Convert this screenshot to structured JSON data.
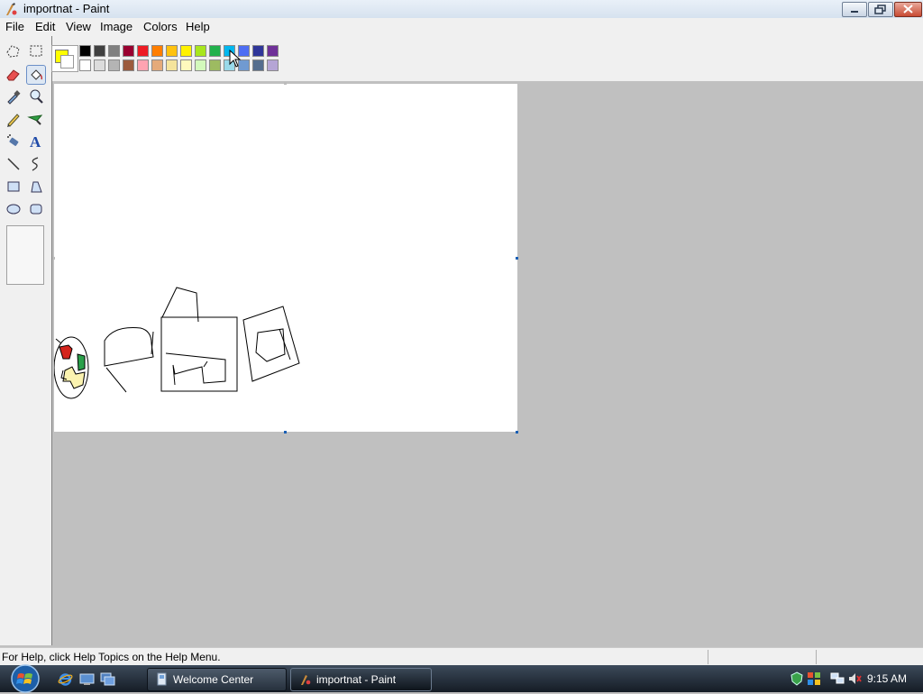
{
  "window": {
    "title": "importnat - Paint"
  },
  "menu": [
    "File",
    "Edit",
    "View",
    "Image",
    "Colors",
    "Help"
  ],
  "tools": [
    {
      "name": "free-form-select",
      "selected": false
    },
    {
      "name": "select",
      "selected": false
    },
    {
      "name": "eraser",
      "selected": false
    },
    {
      "name": "fill-with-color",
      "selected": true
    },
    {
      "name": "pick-color",
      "selected": false
    },
    {
      "name": "magnifier",
      "selected": false
    },
    {
      "name": "pencil",
      "selected": false
    },
    {
      "name": "brush",
      "selected": false
    },
    {
      "name": "airbrush",
      "selected": false
    },
    {
      "name": "text",
      "selected": false
    },
    {
      "name": "line",
      "selected": false
    },
    {
      "name": "curve",
      "selected": false
    },
    {
      "name": "rectangle",
      "selected": false
    },
    {
      "name": "polygon",
      "selected": false
    },
    {
      "name": "ellipse",
      "selected": false
    },
    {
      "name": "rounded-rectangle",
      "selected": false
    }
  ],
  "palette": {
    "foreground": "#ffff00",
    "background": "#ffffff",
    "row1": [
      "#000000",
      "#404040",
      "#808080",
      "#990030",
      "#ed1c24",
      "#ff7e00",
      "#ffc20e",
      "#fff200",
      "#a8e61d",
      "#22b14c",
      "#00b7ef",
      "#4d6df3",
      "#2f3699",
      "#6f3198"
    ],
    "row2": [
      "#ffffff",
      "#dcdcdc",
      "#b4b4b4",
      "#9c5a3c",
      "#ffa3b1",
      "#e5aa7a",
      "#f5e49c",
      "#fff9bd",
      "#d3f9bc",
      "#9dbb61",
      "#99d9ea",
      "#709ad1",
      "#546d8e",
      "#b5a5d5"
    ]
  },
  "status": {
    "text": "For Help, click Help Topics on the Help Menu."
  },
  "taskbar": {
    "buttons": [
      {
        "label": "Welcome Center",
        "active": false
      },
      {
        "label": "importnat - Paint",
        "active": true
      }
    ],
    "clock": "9:15 AM"
  }
}
